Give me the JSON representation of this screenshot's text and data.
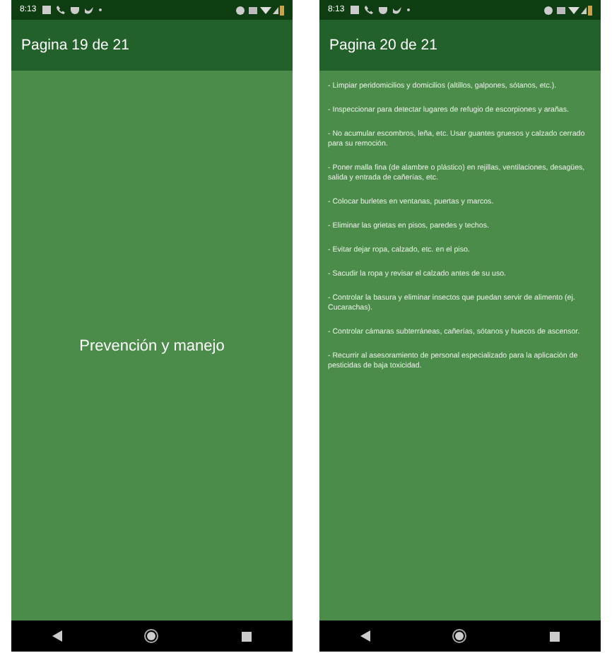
{
  "screens": [
    {
      "status_time": "8:13",
      "title": "Pagina 19 de 21",
      "kind": "centered",
      "body": [
        "Prevención y manejo"
      ]
    },
    {
      "status_time": "8:13",
      "title": "Pagina 20 de 21",
      "kind": "list",
      "body": [
        "- Limpiar peridomicilios y domicilios (altillos, galpones, sótanos, etc.).",
        "- Inspeccionar para detectar lugares de refugio de escorpiones y arañas.",
        "- No acumular escombros, leña, etc. Usar guantes gruesos y calzado cerrado para su remoción.",
        "- Poner malla fina (de alambre o plástico) en rejillas, ventilaciones, desagües, salida y entrada de cañerías, etc.",
        "- Colocar burletes en ventanas, puertas y marcos.",
        "- Eliminar las grietas en pisos, paredes y techos.",
        "- Evitar dejar ropa, calzado, etc. en el piso.",
        "- Sacudir la ropa y revisar el calzado antes de su uso.",
        "- Controlar la basura y eliminar insectos que puedan servir de alimento (ej. Cucarachas).",
        "- Controlar cámaras subterráneas, cañerías, sótanos y huecos de ascensor.",
        "- Recurrir al asesoramiento de personal especializado para la aplicación de pesticidas de baja toxicidad."
      ]
    }
  ]
}
